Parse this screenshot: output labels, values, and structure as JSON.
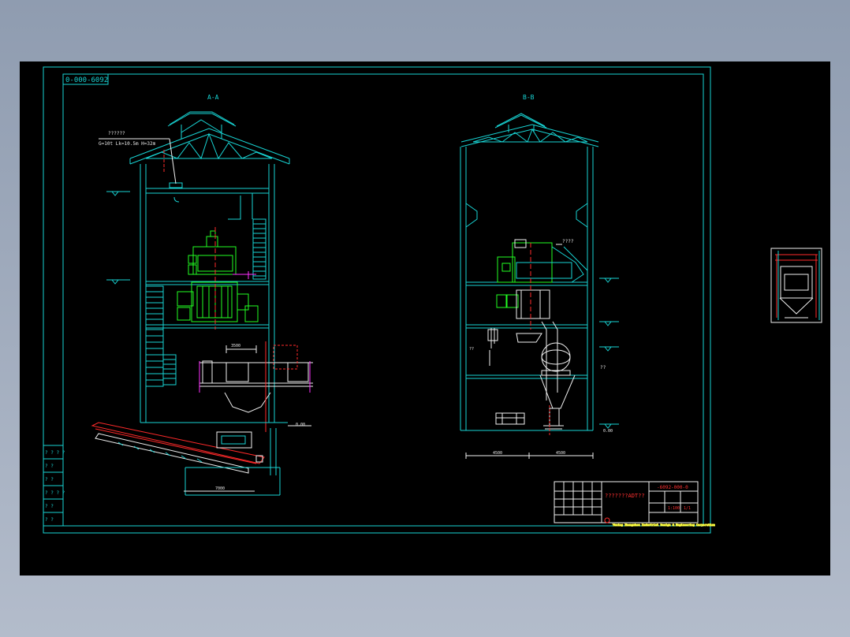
{
  "drawing": {
    "number": "0-000-6092",
    "section_aa_label": "A-A",
    "section_bb_label": "B-B",
    "crane_label": "??????",
    "crane_spec": "G=10t  Lk=10.5m  H=32m",
    "equipment_label": "????",
    "elevation_mark_left": "0.00",
    "elevation_mark_right": "0.00",
    "dim_left_span": "7000",
    "dim_right_span_a": "4500",
    "dim_right_span_b": "4500",
    "dim_hopper": "3500",
    "dim_trough": "7000",
    "annotation_qq": "??"
  },
  "revision_table": {
    "rows": [
      "? ? ? ?",
      "? ?",
      "? ?",
      "? ? ? ?",
      "? ?",
      "? ?"
    ]
  },
  "title_block": {
    "title": "???????ADT??",
    "drawing_no": "-6092-000-0",
    "company": "Yuxing Zhengzhou Industrial Design & Engineering Corporation",
    "scale": "1:100",
    "sheet": "1/1"
  },
  "colors": {
    "background": "#000000",
    "frame": "#18d4d4",
    "equipment": "#22ff22",
    "axis": "#ff2a2a",
    "hopper": "#ff30ff",
    "structure_white": "#f0f0f0"
  }
}
